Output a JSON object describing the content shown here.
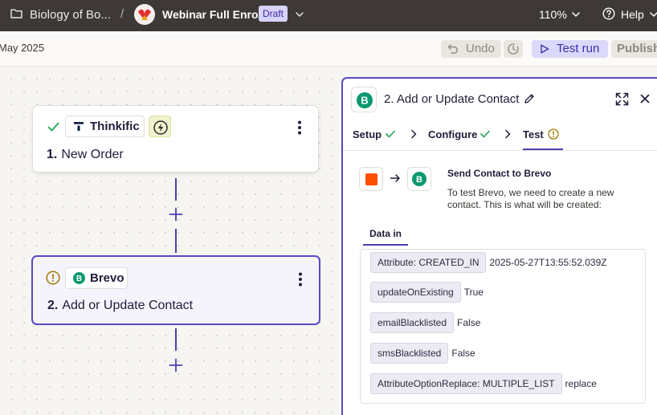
{
  "topbar": {
    "folder_name": "Biology of Bo...",
    "separator": "/",
    "flow_name": "Webinar Full Enrol",
    "status_badge": "Draft",
    "zoom": "110%",
    "help_label": "Help"
  },
  "toolbar": {
    "date_partial": "May 2025",
    "undo_label": "Undo",
    "test_run_label": "Test run",
    "publish_label": "Publish"
  },
  "steps": [
    {
      "app": "Thinkific",
      "number": "1.",
      "title": "New Order",
      "status": "complete"
    },
    {
      "app": "Brevo",
      "number": "2.",
      "title": "Add or Update Contact",
      "status": "warning"
    }
  ],
  "panel": {
    "title": "2. Add or Update Contact",
    "tabs": [
      {
        "label": "Setup",
        "status": "complete"
      },
      {
        "label": "Configure",
        "status": "complete"
      },
      {
        "label": "Test",
        "status": "warning"
      }
    ],
    "send_title": "Send Contact to Brevo",
    "send_desc": "To test Brevo, we need to create a new contact. This is what will be created:",
    "data_tab": "Data in",
    "fields": [
      {
        "key": "Attribute: CREATED_IN",
        "value": "2025-05-27T13:55:52.039Z"
      },
      {
        "key": "updateOnExisting",
        "value": "True"
      },
      {
        "key": "emailBlacklisted",
        "value": "False"
      },
      {
        "key": "smsBlacklisted",
        "value": "False"
      },
      {
        "key": "AttributeOptionReplace: MULTIPLE_LIST",
        "value": "replace"
      }
    ]
  },
  "colors": {
    "accent": "#5a49c2",
    "topbar_bg": "#3e3937",
    "brevo_green": "#0b996e",
    "success_green": "#23a455",
    "warning_amber": "#a07800",
    "zapier_orange": "#ff4f00"
  }
}
